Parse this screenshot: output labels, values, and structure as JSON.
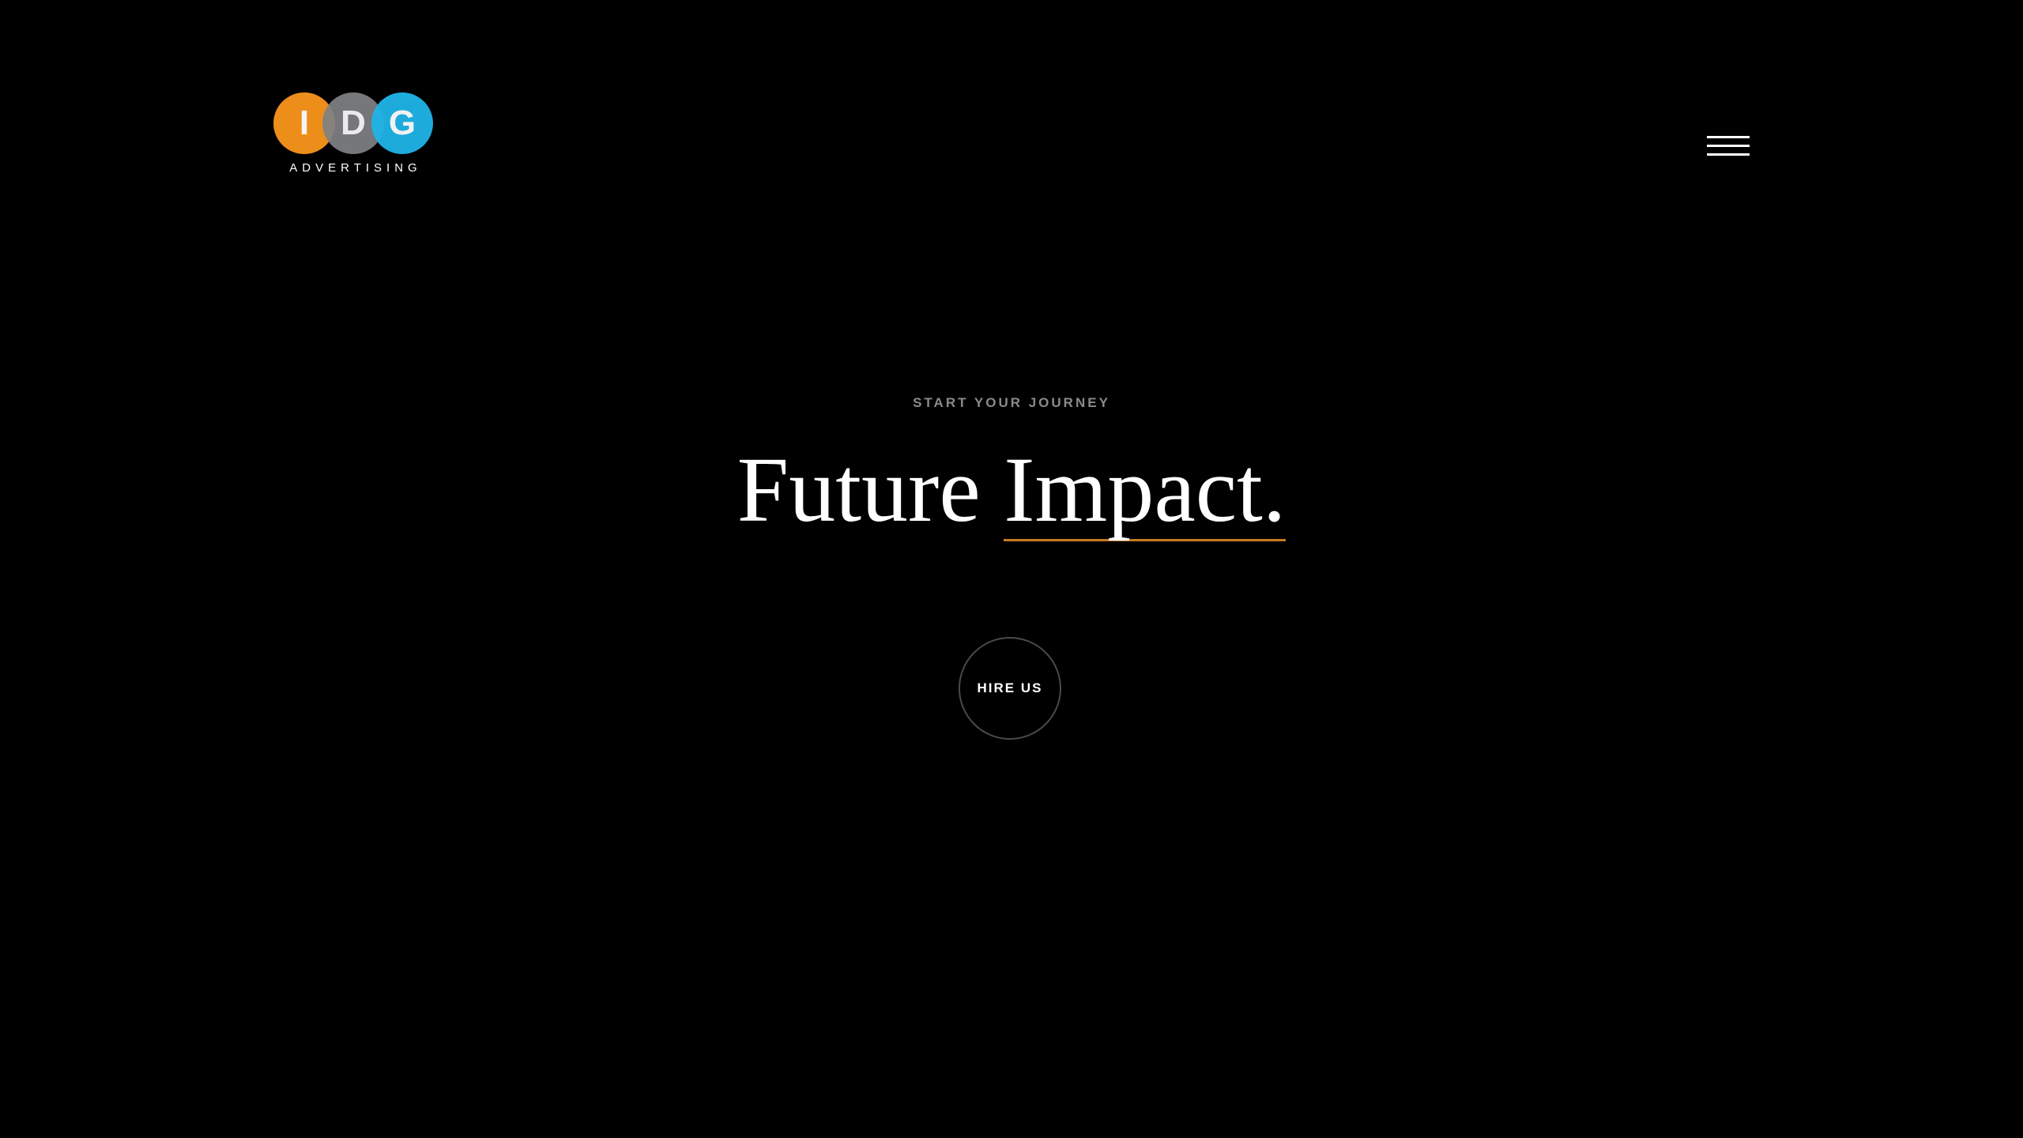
{
  "logo": {
    "letters": [
      "I",
      "D",
      "G"
    ],
    "tagline": "ADVERTISING",
    "colors": [
      "#f7941d",
      "#808285",
      "#1fb5e8"
    ]
  },
  "nav": {
    "menu_icon": "hamburger-menu-icon"
  },
  "hero": {
    "eyebrow": "START YOUR JOURNEY",
    "headline_part1": "Future",
    "headline_part2": "Impact.",
    "underline_color": "#c57a1f",
    "cta_label": "HIRE US"
  }
}
